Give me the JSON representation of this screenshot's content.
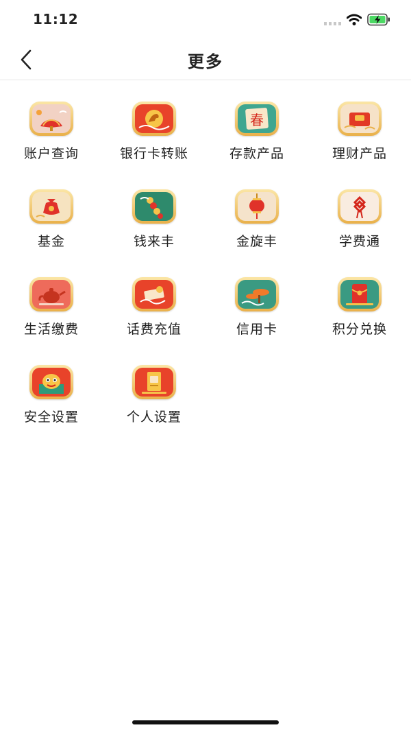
{
  "status_bar": {
    "time": "11:12"
  },
  "header": {
    "title": "更多",
    "back_icon": "chevron-left-icon"
  },
  "items": [
    {
      "label": "账户查询",
      "icon": "folding-fan-icon",
      "bg": "#f2d2c4"
    },
    {
      "label": "银行卡转账",
      "icon": "golden-horse-icon",
      "bg": "#e8432a"
    },
    {
      "label": "存款产品",
      "icon": "spring-character-icon",
      "bg": "#3fa690"
    },
    {
      "label": "理财产品",
      "icon": "red-envelope-box-icon",
      "bg": "#f6e2c8"
    },
    {
      "label": "基金",
      "icon": "money-bag-icon",
      "bg": "#f6e3c0"
    },
    {
      "label": "钱来丰",
      "icon": "coin-string-icon",
      "bg": "#2e8a6c"
    },
    {
      "label": "金旋丰",
      "icon": "lantern-icon",
      "bg": "#f5e3cb"
    },
    {
      "label": "学费通",
      "icon": "chinese-knot-icon",
      "bg": "#f9ece0"
    },
    {
      "label": "生活缴费",
      "icon": "teapot-icon",
      "bg": "#ee6b5b"
    },
    {
      "label": "话费充值",
      "icon": "scroll-ribbon-icon",
      "bg": "#e8432a"
    },
    {
      "label": "信用卡",
      "icon": "pine-tree-cloud-icon",
      "bg": "#3a9a82"
    },
    {
      "label": "积分兑换",
      "icon": "red-packet-icon",
      "bg": "#3a9a82"
    },
    {
      "label": "安全设置",
      "icon": "lion-dance-icon",
      "bg": "#e8432a"
    },
    {
      "label": "个人设置",
      "icon": "gold-card-icon",
      "bg": "#e8432a"
    }
  ]
}
